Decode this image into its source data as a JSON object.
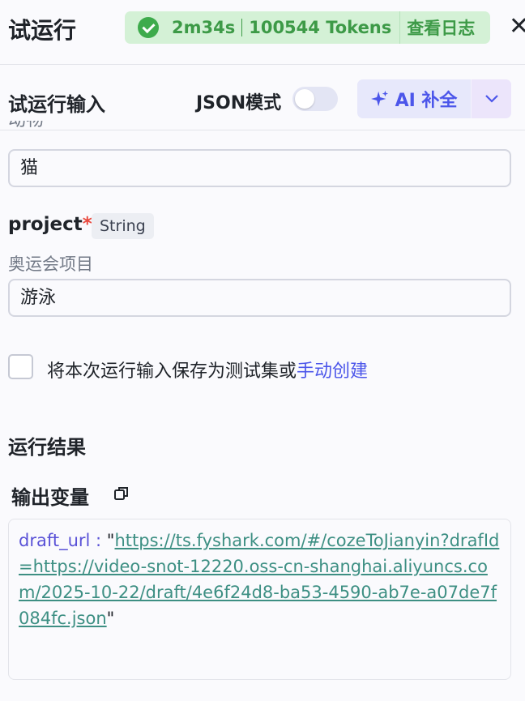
{
  "header": {
    "title": "试运行",
    "status": {
      "duration": "2m34s",
      "tokens": "100544 Tokens",
      "log_link": "查看日志"
    },
    "close_glyph": "✕"
  },
  "input_panel": {
    "title": "试运行输入",
    "json_mode_label": "JSON模式",
    "json_mode_on": false,
    "ai_button_label": "AI 补全"
  },
  "fields": [
    {
      "label": "动物",
      "value": "猫"
    },
    {
      "name": "project",
      "required_mark": "*",
      "type": "String",
      "label": "奥运会项目",
      "value": "游泳"
    }
  ],
  "save_option": {
    "checked": false,
    "label": "将本次运行输入保存为测试集或",
    "link": "手动创建"
  },
  "result": {
    "title": "运行结果",
    "output_title": "输出变量",
    "key": "draft_url : ",
    "open_quote": "\"",
    "url": "https://ts.fyshark.com/#/cozeToJianyin?drafId=https://video-snot-12220.oss-cn-shanghai.aliyuncs.com/2025-10-22/draft/4e6f24d8-ba53-4590-ab7e-a07de7f084fc.json",
    "close_quote": "\""
  },
  "colors": {
    "accent": "#4c56ea",
    "success": "#3d9a47",
    "success_bg": "#d4f1d6",
    "required": "#e94a3f",
    "link_teal": "#3d8f83"
  }
}
